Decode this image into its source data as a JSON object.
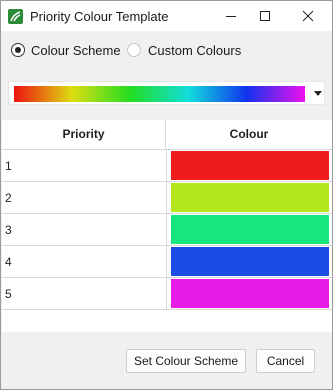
{
  "window": {
    "title": "Priority Colour Template"
  },
  "mode": {
    "options": [
      {
        "label": "Colour Scheme",
        "checked": true
      },
      {
        "label": "Custom Colours",
        "checked": false
      }
    ]
  },
  "scheme": {
    "gradient_colors": [
      "#ee1111",
      "#dddd11",
      "#22dd22",
      "#11dddd",
      "#1133ee",
      "#ee11ee"
    ]
  },
  "table": {
    "columns": [
      "Priority",
      "Colour"
    ],
    "rows": [
      {
        "priority": "1",
        "color": "#ee1c1c"
      },
      {
        "priority": "2",
        "color": "#b3e61b"
      },
      {
        "priority": "3",
        "color": "#17e67e"
      },
      {
        "priority": "4",
        "color": "#1c4ce6"
      },
      {
        "priority": "5",
        "color": "#e61be6"
      }
    ]
  },
  "buttons": {
    "set_label": "Set Colour Scheme",
    "cancel_label": "Cancel"
  }
}
